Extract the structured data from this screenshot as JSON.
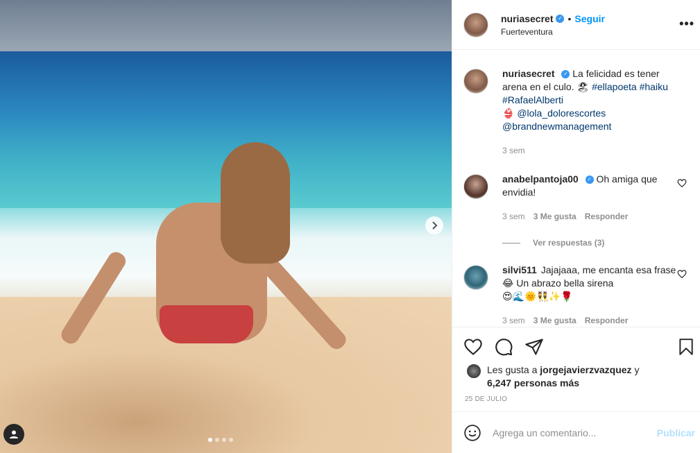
{
  "post": {
    "image_slides": 4,
    "active_slide": 1
  },
  "header": {
    "username": "nuriasecret",
    "separator": "•",
    "follow_label": "Seguir",
    "location": "Fuerteventura",
    "more_label": "•••"
  },
  "caption": {
    "username": "nuriasecret",
    "text_1": "La felicidad es tener arena en el culo. ",
    "emoji_1": "🏖",
    "tag_1": "#ellapoeta",
    "tag_2": "#haiku",
    "tag_3": "#RafaelAlberti",
    "emoji_2": "👙",
    "mention_1": "@lola_dolorescortes",
    "mention_2": "@brandnewmanagement",
    "time": "3 sem"
  },
  "comments": [
    {
      "username": "anabelpantoja00",
      "text": "Oh amiga que envidia!",
      "time": "3 sem",
      "likes": "3 Me gusta",
      "reply": "Responder"
    },
    {
      "username": "silvi511",
      "text": "Jajajaaa, me encanta esa frase 😂 Un abrazo bella sirena",
      "emojis": "😍🌊🌞👯✨🌹",
      "time": "3 sem",
      "likes": "3 Me gusta",
      "reply": "Responder"
    }
  ],
  "view_replies": "Ver respuestas (3)",
  "likes": {
    "prefix": "Les gusta a ",
    "user": "jorgejavierzvazquez",
    "middle": " y ",
    "count": "6,247 personas más"
  },
  "date": "25 DE JULIO",
  "comment_box": {
    "placeholder": "Agrega un comentario...",
    "publish_label": "Publicar"
  },
  "colors": {
    "link": "#00376b",
    "follow": "#0095f6",
    "verified": "#3897f0",
    "muted": "#8e8e8e",
    "publish_disabled": "#b2dffc"
  }
}
